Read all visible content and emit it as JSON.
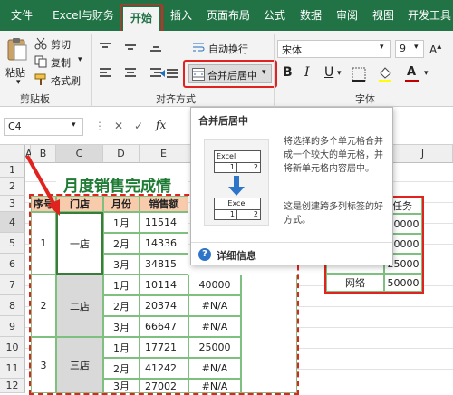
{
  "tabs": [
    {
      "label": "文件"
    },
    {
      "label": "Excel与财务"
    },
    {
      "label": "开始"
    },
    {
      "label": "插入"
    },
    {
      "label": "页面布局"
    },
    {
      "label": "公式"
    },
    {
      "label": "数据"
    },
    {
      "label": "审阅"
    },
    {
      "label": "视图"
    },
    {
      "label": "开发工具"
    }
  ],
  "ribbon": {
    "paste_label": "粘贴",
    "cut_label": "剪切",
    "copy_label": "复制",
    "format_painter_label": "格式刷",
    "clipboard_group": "剪贴板",
    "wrap_text_label": "自动换行",
    "merge_center_label": "合并后居中",
    "alignment_group": "对齐方式",
    "font_name": "宋体",
    "font_size": "9",
    "bold": "B",
    "italic": "I",
    "underline": "U",
    "font_color_glyph": "A",
    "font_group": "字体",
    "highlight_color": "#e0231e",
    "fill_color": "#ffff00",
    "font_color": "#c00000"
  },
  "formula_bar": {
    "name_box": "C4",
    "fx_label": "fx"
  },
  "columns": [
    "A",
    "B",
    "C",
    "D",
    "E",
    "J"
  ],
  "rows": [
    "1",
    "2",
    "3",
    "4",
    "5",
    "6",
    "7",
    "8",
    "9",
    "10",
    "11",
    "12"
  ],
  "sheet": {
    "title": "月度销售完成情",
    "headers": {
      "seq": "序号",
      "store": "门店",
      "month": "月份",
      "sales": "销售额"
    },
    "stores": [
      {
        "seq": "1",
        "name": "一店"
      },
      {
        "seq": "2",
        "name": "二店"
      },
      {
        "seq": "3",
        "name": "三店"
      }
    ],
    "rows": [
      {
        "month": "1月",
        "sales": "11514",
        "f": ""
      },
      {
        "month": "2月",
        "sales": "14336",
        "f": ""
      },
      {
        "month": "3月",
        "sales": "34815",
        "f": ""
      },
      {
        "month": "1月",
        "sales": "10114",
        "f": "40000"
      },
      {
        "month": "2月",
        "sales": "20374",
        "f": "#N/A"
      },
      {
        "month": "3月",
        "sales": "66647",
        "f": "#N/A"
      },
      {
        "month": "1月",
        "sales": "17721",
        "f": "25000"
      },
      {
        "month": "2月",
        "sales": "41242",
        "f": "#N/A"
      },
      {
        "month": "3月",
        "sales": "27002",
        "f": "#N/A"
      }
    ],
    "side_table": {
      "header": "月任务",
      "rows": [
        {
          "name": "",
          "value": "20000"
        },
        {
          "name": "",
          "value": "40000"
        },
        {
          "name": "",
          "value": "25000"
        },
        {
          "name": "网络",
          "value": "50000"
        }
      ]
    }
  },
  "tooltip": {
    "title": "合并后居中",
    "description": "将选择的多个单元格合并成一个较大的单元格，并将新单元格内容居中。",
    "note": "这是创建跨多列标签的好方式。",
    "diagram_top_label": "Excel",
    "diagram_bottom_label": "Excel",
    "diagram_cell_1": "1",
    "diagram_cell_2": "2",
    "more_info": "详细信息"
  }
}
